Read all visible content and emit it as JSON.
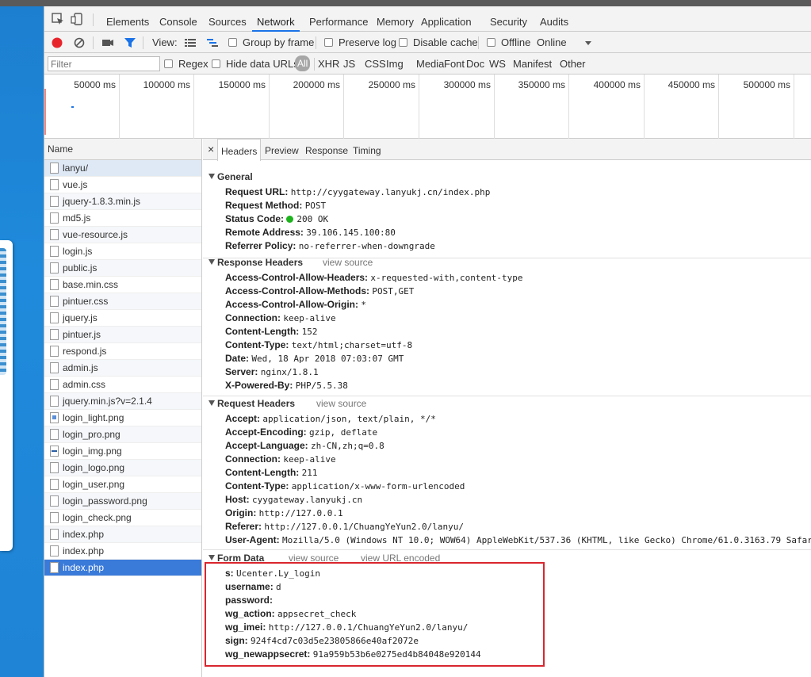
{
  "devtools_tabs": [
    "Elements",
    "Console",
    "Sources",
    "Network",
    "Performance",
    "Memory",
    "Application",
    "Security",
    "Audits"
  ],
  "active_tab": "Network",
  "controls": {
    "view_label": "View:",
    "group_by_frame": "Group by frame",
    "preserve_log": "Preserve log",
    "disable_cache": "Disable cache",
    "offline": "Offline",
    "throttle": "Online"
  },
  "filter": {
    "placeholder": "Filter",
    "regex": "Regex",
    "hide_data_urls": "Hide data URLs",
    "types": [
      "All",
      "XHR",
      "JS",
      "CSS",
      "Img",
      "Media",
      "Font",
      "Doc",
      "WS",
      "Manifest",
      "Other"
    ]
  },
  "timeline_ticks": [
    "50000 ms",
    "100000 ms",
    "150000 ms",
    "200000 ms",
    "250000 ms",
    "300000 ms",
    "350000 ms",
    "400000 ms",
    "450000 ms",
    "500000 ms"
  ],
  "name_header": "Name",
  "files": [
    {
      "name": "lanyu/",
      "icon": "file"
    },
    {
      "name": "vue.js",
      "icon": "file"
    },
    {
      "name": "jquery-1.8.3.min.js",
      "icon": "file"
    },
    {
      "name": "md5.js",
      "icon": "file"
    },
    {
      "name": "vue-resource.js",
      "icon": "file"
    },
    {
      "name": "login.js",
      "icon": "file"
    },
    {
      "name": "public.js",
      "icon": "file"
    },
    {
      "name": "base.min.css",
      "icon": "file"
    },
    {
      "name": "pintuer.css",
      "icon": "file"
    },
    {
      "name": "jquery.js",
      "icon": "file"
    },
    {
      "name": "pintuer.js",
      "icon": "file"
    },
    {
      "name": "respond.js",
      "icon": "file"
    },
    {
      "name": "admin.js",
      "icon": "file"
    },
    {
      "name": "admin.css",
      "icon": "file"
    },
    {
      "name": "jquery.min.js?v=2.1.4",
      "icon": "file"
    },
    {
      "name": "login_light.png",
      "icon": "image"
    },
    {
      "name": "login_pro.png",
      "icon": "file"
    },
    {
      "name": "login_img.png",
      "icon": "image-bar"
    },
    {
      "name": "login_logo.png",
      "icon": "file"
    },
    {
      "name": "login_user.png",
      "icon": "file"
    },
    {
      "name": "login_password.png",
      "icon": "file"
    },
    {
      "name": "login_check.png",
      "icon": "file"
    },
    {
      "name": "index.php",
      "icon": "file"
    },
    {
      "name": "index.php",
      "icon": "file"
    },
    {
      "name": "index.php",
      "icon": "file",
      "selected": true
    }
  ],
  "detail_tabs": {
    "close": "×",
    "items": [
      "Headers",
      "Preview",
      "Response",
      "Timing"
    ]
  },
  "general": {
    "title": "General",
    "rows": [
      {
        "k": "Request URL:",
        "v": "http://cyygateway.lanyukj.cn/index.php"
      },
      {
        "k": "Request Method:",
        "v": "POST"
      },
      {
        "k": "Status Code:",
        "v": "200 OK",
        "status": true
      },
      {
        "k": "Remote Address:",
        "v": "39.106.145.100:80"
      },
      {
        "k": "Referrer Policy:",
        "v": "no-referrer-when-downgrade"
      }
    ]
  },
  "response_headers": {
    "title": "Response Headers",
    "link": "view source",
    "rows": [
      {
        "k": "Access-Control-Allow-Headers:",
        "v": "x-requested-with,content-type"
      },
      {
        "k": "Access-Control-Allow-Methods:",
        "v": "POST,GET"
      },
      {
        "k": "Access-Control-Allow-Origin:",
        "v": "*"
      },
      {
        "k": "Connection:",
        "v": "keep-alive"
      },
      {
        "k": "Content-Length:",
        "v": "152"
      },
      {
        "k": "Content-Type:",
        "v": "text/html;charset=utf-8"
      },
      {
        "k": "Date:",
        "v": "Wed, 18 Apr 2018 07:03:07 GMT"
      },
      {
        "k": "Server:",
        "v": "nginx/1.8.1"
      },
      {
        "k": "X-Powered-By:",
        "v": "PHP/5.5.38"
      }
    ]
  },
  "request_headers": {
    "title": "Request Headers",
    "link": "view source",
    "rows": [
      {
        "k": "Accept:",
        "v": "application/json, text/plain, */*"
      },
      {
        "k": "Accept-Encoding:",
        "v": "gzip, deflate"
      },
      {
        "k": "Accept-Language:",
        "v": "zh-CN,zh;q=0.8"
      },
      {
        "k": "Connection:",
        "v": "keep-alive"
      },
      {
        "k": "Content-Length:",
        "v": "211"
      },
      {
        "k": "Content-Type:",
        "v": "application/x-www-form-urlencoded"
      },
      {
        "k": "Host:",
        "v": "cyygateway.lanyukj.cn"
      },
      {
        "k": "Origin:",
        "v": "http://127.0.0.1"
      },
      {
        "k": "Referer:",
        "v": "http://127.0.0.1/ChuangYeYun2.0/lanyu/"
      },
      {
        "k": "User-Agent:",
        "v": "Mozilla/5.0 (Windows NT 10.0; WOW64) AppleWebKit/537.36 (KHTML, like Gecko) Chrome/61.0.3163.79 Safar"
      }
    ]
  },
  "form_data": {
    "title": "Form Data",
    "link1": "view source",
    "link2": "view URL encoded",
    "rows": [
      {
        "k": "s:",
        "v": "Ucenter.Ly_login"
      },
      {
        "k": "username:",
        "v": "d"
      },
      {
        "k": "password:",
        "v": ""
      },
      {
        "k": "wg_action:",
        "v": "appsecret_check"
      },
      {
        "k": "wg_imei:",
        "v": "http://127.0.0.1/ChuangYeYun2.0/lanyu/"
      },
      {
        "k": "sign:",
        "v": "924f4cd7c03d5e23805866e40af2072e"
      },
      {
        "k": "wg_newappsecret:",
        "v": "91a959b53b6e0275ed4b84048e920144"
      }
    ]
  },
  "colors": {
    "accent": "#1a73e8",
    "record": "#e8242b",
    "status_ok": "#1db31d",
    "selected_row": "#3a7ad9",
    "highlight_box": "#d9262e"
  }
}
